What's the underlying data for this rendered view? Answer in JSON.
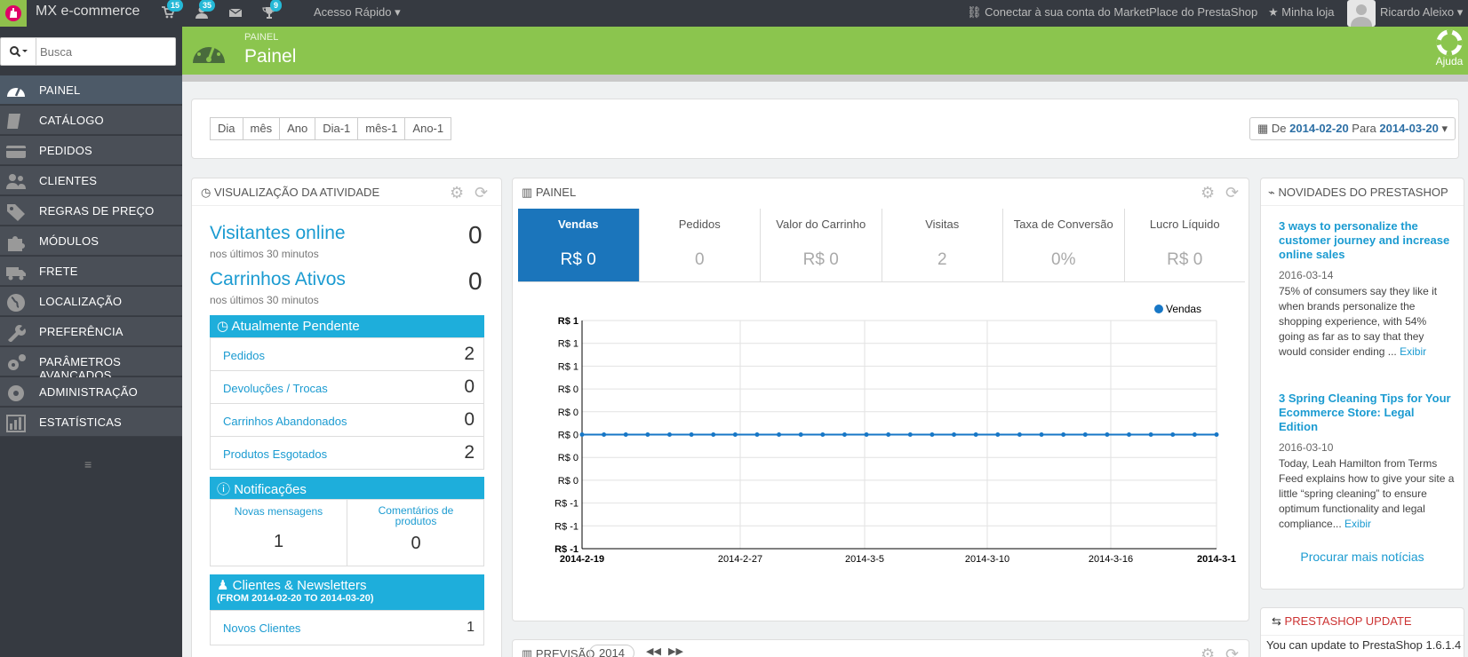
{
  "topbar": {
    "brand": "MX e-commerce",
    "cart_count": "15",
    "customers_count": "35",
    "messages_count": "",
    "trophy_count": "9",
    "quick_access": "Acesso Rápido",
    "marketplace": "Conectar à sua conta do MarketPlace do PrestaShop",
    "my_store": "Minha loja",
    "user": "Ricardo Aleixo"
  },
  "search": {
    "placeholder": "Busca"
  },
  "sidebar": {
    "items": [
      {
        "label": "PAINEL",
        "icon": "dashboard-icon"
      },
      {
        "label": "CATÁLOGO",
        "icon": "book-icon"
      },
      {
        "label": "PEDIDOS",
        "icon": "credit-card-icon"
      },
      {
        "label": "CLIENTES",
        "icon": "users-icon"
      },
      {
        "label": "REGRAS DE PREÇO",
        "icon": "tags-icon"
      },
      {
        "label": "MÓDULOS",
        "icon": "puzzle-icon"
      },
      {
        "label": "FRETE",
        "icon": "truck-icon"
      },
      {
        "label": "LOCALIZAÇÃO",
        "icon": "globe-icon"
      },
      {
        "label": "PREFERÊNCIA",
        "icon": "wrench-icon"
      },
      {
        "label": "PARÂMETROS AVANÇADOS",
        "icon": "cogs-icon"
      },
      {
        "label": "ADMINISTRAÇÃO",
        "icon": "gear-icon"
      },
      {
        "label": "ESTATÍSTICAS",
        "icon": "bar-chart-icon"
      }
    ]
  },
  "header": {
    "breadcrumb": "PAINEL",
    "title": "Painel",
    "help": "Ajuda"
  },
  "filters": {
    "buttons": [
      "Dia",
      "mês",
      "Ano",
      "Dia-1",
      "mês-1",
      "Ano-1"
    ],
    "date_from_label": "De",
    "date_from": "2014-02-20",
    "date_to_label": "Para",
    "date_to": "2014-03-20"
  },
  "activity": {
    "title": "VISUALIZAÇÃO DA ATIVIDADE",
    "online_label": "Visitantes online",
    "online_sub": "nos últimos 30 minutos",
    "online_value": "0",
    "carts_label": "Carrinhos Ativos",
    "carts_sub": "nos últimos 30 minutos",
    "carts_value": "0",
    "pending_title": "Atualmente Pendente",
    "pending": [
      {
        "label": "Pedidos",
        "value": "2"
      },
      {
        "label": "Devoluções / Trocas",
        "value": "0"
      },
      {
        "label": "Carrinhos Abandonados",
        "value": "0"
      },
      {
        "label": "Produtos Esgotados",
        "value": "2"
      }
    ],
    "notif_title": "Notificações",
    "notif_msgs_label": "Novas mensagens",
    "notif_msgs_value": "1",
    "notif_comments_label": "Comentários de produtos",
    "notif_comments_value": "0",
    "clients_title": "Clientes & Newsletters",
    "clients_sub": "(FROM 2014-02-20 TO 2014-03-20)",
    "new_clients_label": "Novos Clientes",
    "new_clients_value": "1"
  },
  "dash": {
    "title": "PAINEL",
    "kpis": [
      {
        "label": "Vendas",
        "value": "R$ 0"
      },
      {
        "label": "Pedidos",
        "value": "0"
      },
      {
        "label": "Valor do Carrinho",
        "value": "R$ 0"
      },
      {
        "label": "Visitas",
        "value": "2"
      },
      {
        "label": "Taxa de Conversão",
        "value": "0%"
      },
      {
        "label": "Lucro Líquido",
        "value": "R$ 0"
      }
    ],
    "forecast_title": "PREVISÃO",
    "forecast_year": "2014"
  },
  "chart_data": {
    "type": "line",
    "series": [
      {
        "name": "Vendas",
        "values": [
          0,
          0,
          0,
          0,
          0,
          0,
          0,
          0,
          0,
          0,
          0,
          0,
          0,
          0,
          0,
          0,
          0,
          0,
          0,
          0,
          0,
          0,
          0,
          0,
          0,
          0,
          0,
          0,
          0,
          0
        ]
      }
    ],
    "yticks": [
      "R$ 1",
      "R$ 1",
      "R$ 1",
      "R$ 0",
      "R$ 0",
      "R$ 0",
      "R$ 0",
      "R$ 0",
      "R$ -1",
      "R$ -1",
      "R$ -1"
    ],
    "xticks": [
      "2014-2-19",
      "2014-2-27",
      "2014-3-5",
      "2014-3-10",
      "2014-3-16",
      "2014-3-1"
    ],
    "ylim": [
      -1,
      1
    ],
    "grid": true,
    "legend": "top-right",
    "color": "#1777c6"
  },
  "news": {
    "title": "NOVIDADES DO PRESTASHOP",
    "items": [
      {
        "title": "3 ways to personalize the customer journey and increase online sales",
        "date": "2016-03-14",
        "body": "75% of consumers say they like it when brands personalize the shopping experience, with 54% going as far as to say that they would consider ending ...",
        "more": "Exibir"
      },
      {
        "title": "3 Spring Cleaning Tips for Your Ecommerce Store: Legal Edition",
        "date": "2016-03-10",
        "body": "Today, Leah Hamilton from Terms Feed explains how to give your site a little “spring cleaning” to ensure optimum functionality and legal compliance...",
        "more": "Exibir"
      }
    ],
    "more_news": "Procurar mais notícias",
    "update_title": "PRESTASHOP UPDATE",
    "update_text": "You can update to PrestaShop 1.6.1.4"
  }
}
